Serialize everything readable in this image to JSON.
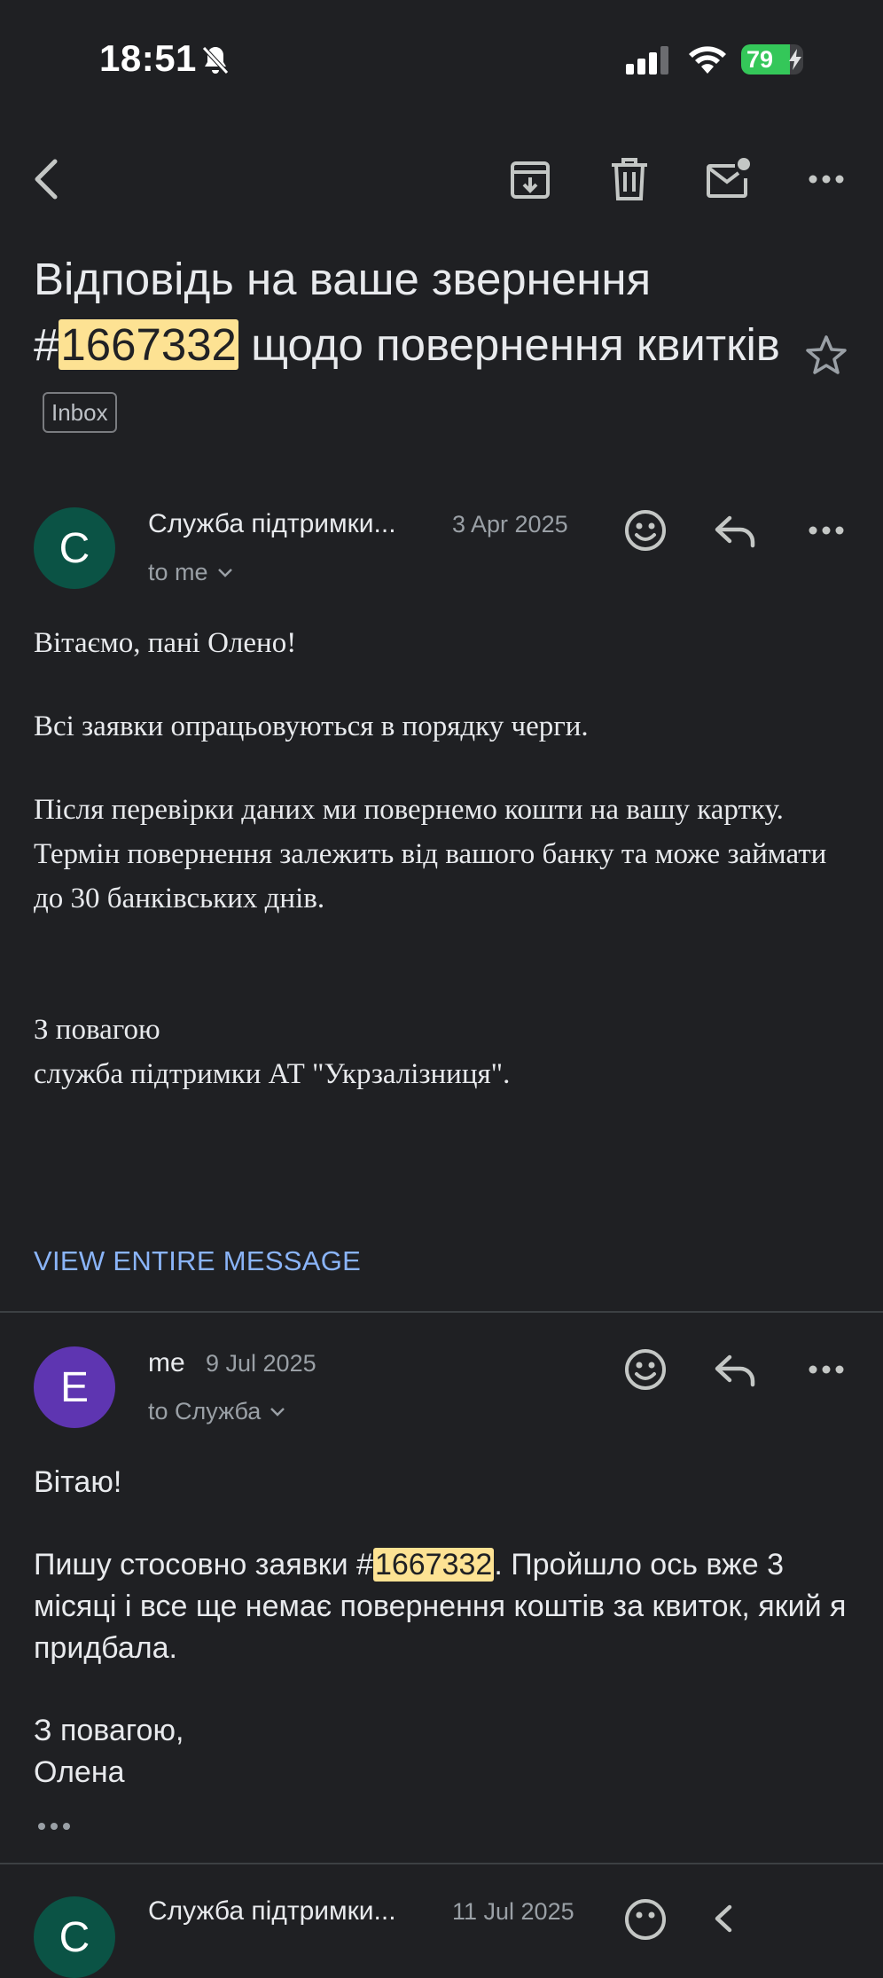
{
  "status_bar": {
    "time": "18:51",
    "battery": "79",
    "battery_percent": 79
  },
  "toolbar": {
    "back_icon": "chevron-left-icon",
    "archive_icon": "archive-icon",
    "delete_icon": "trash-icon",
    "mark_unread_icon": "mail-unread-icon",
    "more_icon": "more-horizontal-icon"
  },
  "subject": {
    "part1": "Відповідь на ваше звернення #",
    "highlight": "1667332",
    "part2": " щодо повернення квитків",
    "label": "Inbox"
  },
  "messages": [
    {
      "avatar_letter": "C",
      "avatar_color": "#0b5345",
      "sender": "Служба підтримки...",
      "date": "3 Apr 2025",
      "recipient": "to me",
      "body": {
        "greeting": "Вітаємо, пані Олено!",
        "p1": "Всі заявки опрацьовуються в порядку черги.",
        "p2": "Після перевірки даних ми повернемо кошти на вашу картку. Термін повернення залежить від вашого банку та може займати до 30 банківських днів.",
        "sign1": "З повагою",
        "sign2": "служба підтримки АТ \"Укрзалізниця\"."
      },
      "view_link": "VIEW ENTIRE MESSAGE"
    },
    {
      "avatar_letter": "E",
      "avatar_color": "#5e35b1",
      "sender": "me",
      "date": "9 Jul 2025",
      "recipient": "to Служба",
      "body": {
        "greeting": "Вітаю!",
        "p1_before": "Пишу стосовно заявки #",
        "p1_highlight": "1667332",
        "p1_after": ". Пройшло ось вже 3 місяці і все ще немає повернення коштів за квиток, який я придбала.",
        "sign1": "З повагою,",
        "sign2": "Олена"
      },
      "trimmed": "•••"
    },
    {
      "avatar_letter": "C",
      "avatar_color": "#0b5345",
      "sender": "Служба підтримки...",
      "date": "11 Jul 2025"
    }
  ],
  "colors": {
    "background": "#1f2023",
    "link": "#8ab4f8",
    "highlight": "#fde293",
    "battery": "#34c759"
  }
}
